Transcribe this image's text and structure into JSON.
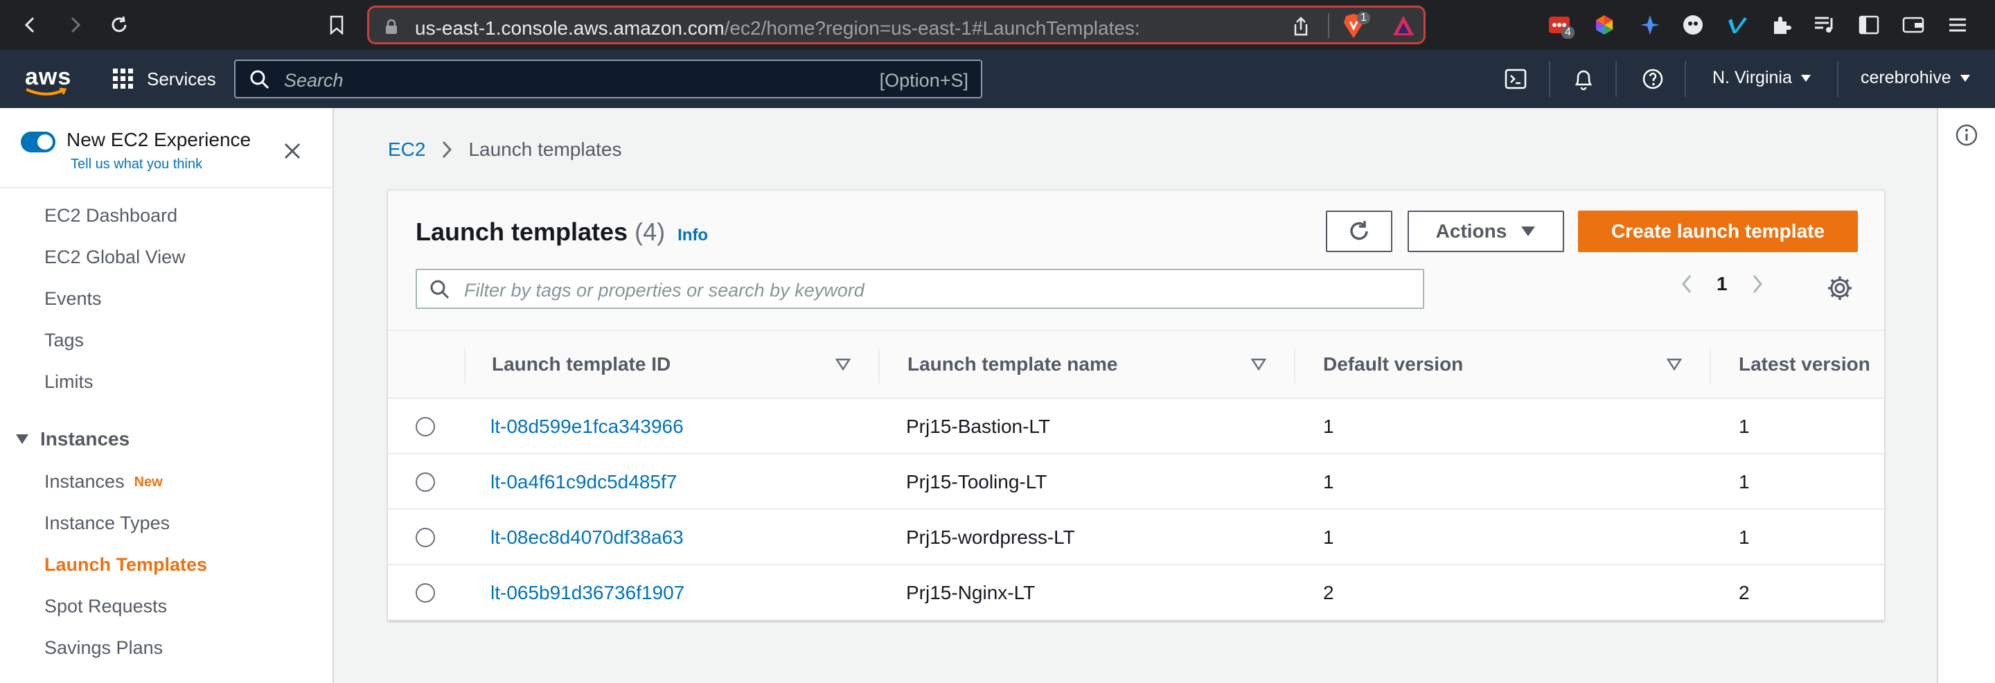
{
  "browser": {
    "url_host": "us-east-1.console.aws.amazon.com",
    "url_path": "/ec2/home?region=us-east-1#LaunchTemplates:",
    "brave_badge": "1",
    "ext_badge": "4"
  },
  "aws_nav": {
    "logo": "aws",
    "services_label": "Services",
    "search_placeholder": "Search",
    "search_shortcut": "[Option+S]",
    "region": "N. Virginia",
    "account": "cerebrohive"
  },
  "sidebar": {
    "experience_title": "New EC2 Experience",
    "experience_feedback": "Tell us what you think",
    "items": [
      {
        "label": "EC2 Dashboard"
      },
      {
        "label": "EC2 Global View"
      },
      {
        "label": "Events"
      },
      {
        "label": "Tags"
      },
      {
        "label": "Limits"
      }
    ],
    "section_title": "Instances",
    "section_items": [
      {
        "label": "Instances",
        "badge": "New"
      },
      {
        "label": "Instance Types"
      },
      {
        "label": "Launch Templates"
      },
      {
        "label": "Spot Requests"
      },
      {
        "label": "Savings Plans"
      }
    ]
  },
  "breadcrumb": {
    "root": "EC2",
    "current": "Launch templates"
  },
  "panel": {
    "title": "Launch templates",
    "count": "(4)",
    "info_label": "Info",
    "actions_label": "Actions",
    "create_label": "Create launch template",
    "filter_placeholder": "Filter by tags or properties or search by keyword",
    "page": "1"
  },
  "table": {
    "columns": [
      "Launch template ID",
      "Launch template name",
      "Default version",
      "Latest version"
    ],
    "rows": [
      {
        "id": "lt-08d599e1fca343966",
        "name": "Prj15-Bastion-LT",
        "default_version": "1",
        "latest_version": "1"
      },
      {
        "id": "lt-0a4f61c9dc5d485f7",
        "name": "Prj15-Tooling-LT",
        "default_version": "1",
        "latest_version": "1"
      },
      {
        "id": "lt-08ec8d4070df38a63",
        "name": "Prj15-wordpress-LT",
        "default_version": "1",
        "latest_version": "1"
      },
      {
        "id": "lt-065b91d36736f1907",
        "name": "Prj15-Nginx-LT",
        "default_version": "2",
        "latest_version": "2"
      }
    ]
  },
  "colors": {
    "accent_orange": "#ec7211",
    "link_blue": "#0073bb",
    "aws_nav_bg": "#232f3e"
  }
}
